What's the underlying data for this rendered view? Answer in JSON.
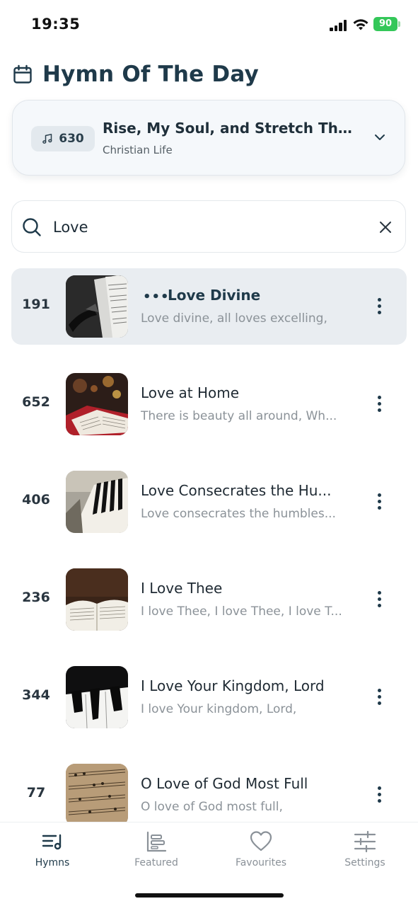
{
  "status_bar": {
    "time": "19:35",
    "battery": "90"
  },
  "header": {
    "title": "Hymn Of The Day",
    "icon": "calendar-icon"
  },
  "hymn_of_the_day": {
    "number": "630",
    "title": "Rise, My Soul, and Stretch Thy...",
    "category": "Christian Life"
  },
  "search": {
    "value": "Love",
    "placeholder": ""
  },
  "hymns": [
    {
      "number": "191",
      "title": "Love Divine",
      "snippet": "Love divine, all loves excelling,",
      "playing": true,
      "playing_indicator": "•••"
    },
    {
      "number": "652",
      "title": "Love at Home",
      "snippet": "There is beauty all around, Wh..."
    },
    {
      "number": "406",
      "title": "Love Consecrates the Hu...",
      "snippet": "Love consecrates the humbles..."
    },
    {
      "number": "236",
      "title": "I Love Thee",
      "snippet": "I love Thee, I love Thee, I love T..."
    },
    {
      "number": "344",
      "title": "I Love Your Kingdom, Lord",
      "snippet": "I love Your kingdom, Lord,"
    },
    {
      "number": "77",
      "title": "O Love of God Most Full",
      "snippet": "O love of God most full,"
    }
  ],
  "bottom_nav": [
    {
      "label": "Hymns",
      "icon": "hymns-list-icon",
      "selected": true
    },
    {
      "label": "Featured",
      "icon": "featured-icon"
    },
    {
      "label": "Favourites",
      "icon": "heart-icon"
    },
    {
      "label": "Settings",
      "icon": "sliders-icon"
    }
  ],
  "colors": {
    "accent": "#1f3a4a",
    "muted": "#8b9298",
    "active_row": "#e9edf1"
  }
}
